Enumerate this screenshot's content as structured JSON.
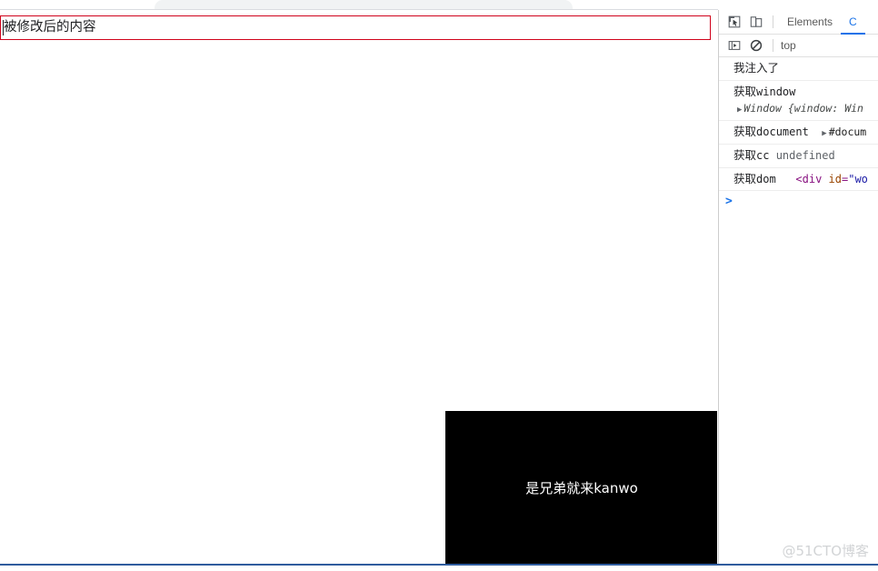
{
  "browser": {
    "tab_strip_visible": true
  },
  "page": {
    "editable_box": {
      "value": "被修改后的内容",
      "border_color": "#d0021b",
      "focused": true
    },
    "media_block": {
      "caption": "是兄弟就来kanwo",
      "background_color": "#000000",
      "text_color": "#ffffff"
    }
  },
  "devtools": {
    "toolbar": {
      "inspect_icon": "inspect-element-icon",
      "device_icon": "device-toolbar-icon",
      "tabs": [
        {
          "label": "Elements",
          "active": false
        },
        {
          "label": "C",
          "active": true
        }
      ],
      "accent_color": "#1a73e8"
    },
    "subbar": {
      "sidebar_icon": "console-sidebar-icon",
      "clear_icon": "clear-console-icon",
      "context": "top"
    },
    "console": {
      "rows": [
        {
          "cjk": "我注入了",
          "mono": "",
          "extra": ""
        },
        {
          "cjk": "获取",
          "mono": "window",
          "extra": ""
        },
        {
          "cjk": "",
          "mono": "",
          "object_preview": "Window {window: Win"
        },
        {
          "cjk": "获取",
          "mono": "document",
          "node_ref": "#docum"
        },
        {
          "cjk": "获取",
          "mono": "cc",
          "undefined_value": "undefined"
        },
        {
          "cjk": "获取",
          "mono": "dom",
          "html_open": "<",
          "html_tag": "div",
          "html_attr": "id",
          "html_eq": "=",
          "html_value": "\"wo"
        }
      ],
      "prompt_caret": ">"
    }
  },
  "footer": {
    "watermark": "@51CTO博客",
    "rule_color": "#2f5c9e"
  }
}
